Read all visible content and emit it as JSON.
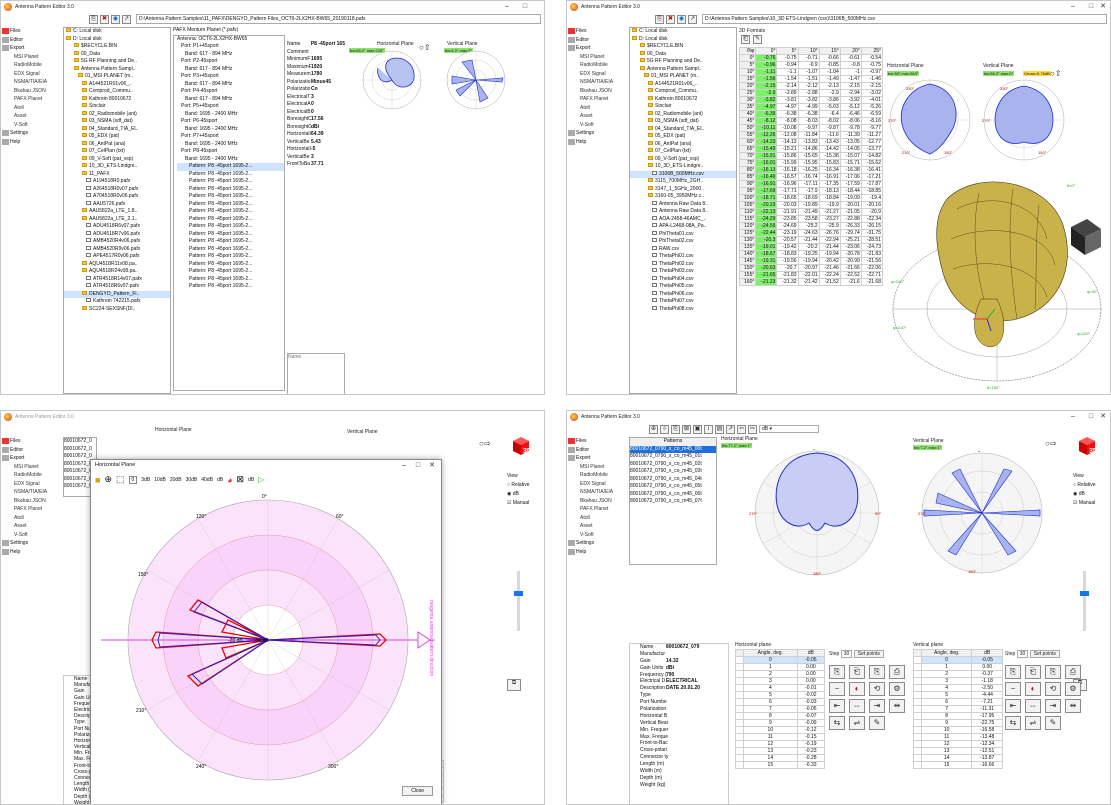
{
  "app_title": "Antenna Pattern Editor 3.0",
  "window_controls": {
    "min": "–",
    "max": "□",
    "close": "✕"
  },
  "sidebar": [
    {
      "label": "Files",
      "level": 0
    },
    {
      "label": "Editor",
      "level": 0
    },
    {
      "label": "Export",
      "level": 0
    },
    {
      "label": "MSI Planet",
      "level": 1
    },
    {
      "label": "RadioMobile",
      "level": 1
    },
    {
      "label": "EDX Signal",
      "level": 1
    },
    {
      "label": "NSMA/TIA/EIA",
      "level": 1
    },
    {
      "label": "Bkahau JSON",
      "level": 1
    },
    {
      "label": "PAFX Planet",
      "level": 1
    },
    {
      "label": "Atoll",
      "level": 1
    },
    {
      "label": "Asset",
      "level": 1
    },
    {
      "label": "V-Soft",
      "level": 1
    },
    {
      "label": "Settings",
      "level": 0
    },
    {
      "label": "Help",
      "level": 0
    }
  ],
  "view": {
    "label": "View",
    "relative": "Relative",
    "db": "dB",
    "manual": "Manual",
    "btn3d": "3D"
  },
  "win1": {
    "path": "D:\\Antenna Pattern Samples\\11_PAFX\\DENGYO_Pattern Files_OCT6-2LX2HX-BW65_20190118.pafx",
    "folders": [
      "C: Local disk",
      "D: Local disk",
      "$RECYCLE.BIN",
      "00_Data",
      "5G RF Planning and De..",
      "Antenna Pattern Sampl..",
      "01_MSI PLANET (m..",
      "A144521R01v06_..",
      "Comprod_Commu..",
      "Kathrein 80010672",
      "Sinclair",
      "02_Radiomobile (ant)",
      "03_NSMA (sdf_dat)",
      "04_Standard_TIA_EI..",
      "05_EDX (pat)",
      "06_AntPat (ana)",
      "07_CelPlan (txt)",
      "09_V-Soft (pat_vsp)",
      "10_3D_ETS-Lindgre..",
      "11_PAFX",
      "A194518R0.pafx",
      "A264518R0v07.pafx",
      "A704518R0v06.pafx",
      "AAU5726.pafx",
      "AAU5822a_LTE_1.8..",
      "AAU5822a_LTE_2.1..",
      "ADU4518R6v07.pafx",
      "ADU4518R7v06.pafx",
      "AMB4520R4v06.pafx",
      "AMB4520R9v06.pafx",
      "APE4517R0v06.pafx",
      "AQU4518R11v08.pa..",
      "AQU4518R24v08.pa..",
      "ATR4518R14v07.pafx",
      "ATR4518R6v07.pafx",
      "DENGYO_Pattern_Fi..",
      "Kathrein 742215.pafx",
      "SC224-SEXSNF(DI.."
    ],
    "pafx_header": "PAFX Mentum Planet (*.pafx)",
    "pafx_items": [
      "Antenna: OCT6-2LX2HX-BW65",
      "Port: P1+45sport",
      "Band: 617 - 894 MHz",
      "Port: P2-45sport",
      "Band: 617 - 894 MHz",
      "Port: P3+45sport",
      "Band: 617 - 894 MHz",
      "Port: P4-45sport",
      "Band: 617 - 894 MHz",
      "Port: P5+45sport",
      "Band: 1695 - 2400 MHz",
      "Port: P6-45sport",
      "Band: 1695 - 2400 MHz",
      "Port: P7+45sport",
      "Band: 1695 - 2400 MHz",
      "Port: P8-45sport",
      "Band: 1695 - 2400 MHz",
      "Pattern: P8 -45port 1695-2...",
      "Pattern: P8 -45port 1695-2...",
      "Pattern: P8 -45port 1695-2...",
      "Pattern: P8 -45port 1695-2...",
      "Pattern: P8 -45port 1695-2...",
      "Pattern: P8 -45port 1695-2...",
      "Pattern: P8 -45port 1695-2...",
      "Pattern: P8 -45port 1695-2...",
      "Pattern: P8 -45port 1695-2...",
      "Pattern: P8 -45port 1695-2...",
      "Pattern: P8 -45port 1695-2...",
      "Pattern: P8 -45port 1695-2...",
      "Pattern: P8 -45port 1695-2...",
      "Pattern: P8 -45port 1695-2...",
      "Pattern: P8 -45port 1695-2...",
      "Pattern: P8 -45port 1695-2...",
      "Pattern: P8 -45port 1695-2..."
    ],
    "props": [
      [
        "Name",
        "P8 -45port 165"
      ],
      [
        "Comment",
        ""
      ],
      [
        "MinimumF",
        "1695"
      ],
      [
        "MaximumF",
        "1920"
      ],
      [
        "Measurem",
        "1780"
      ],
      [
        "Polarizatio",
        "Minus45"
      ],
      [
        "Polarizatio",
        "Co"
      ],
      [
        "ElectricalT",
        "3"
      ],
      [
        "ElectricalA",
        "0"
      ],
      [
        "ElectricalB",
        "0"
      ],
      [
        "BoresightC",
        "17.56"
      ],
      [
        "BoresightG",
        "dBi"
      ],
      [
        "HorizontalI",
        "64.39"
      ],
      [
        "VerticalBe",
        "5.43"
      ],
      [
        "HorizontalI",
        "-5"
      ],
      [
        "VerticalBe",
        "3"
      ],
      [
        "FrontToBa",
        "37.71"
      ]
    ],
    "name_label": "Name",
    "h_plane": "Horizontal Plane",
    "h_badge": "bw:65.2° max:233°",
    "v_plane": "Vertical Plane",
    "v_badge": "bw:4.3° max:3°"
  },
  "win2": {
    "path": "D:\\Antenna Pattern Samples\\10_3D ETS-Lindgren (csv)\\3106B_500MHz.csv",
    "formats": "3D Formats",
    "folders": [
      "C: Local disk",
      "D: Local disk",
      "$RECYCLE.BIN",
      "00_Data",
      "5G RF Planning and De..",
      "Antenna Pattern Sampl..",
      "01_MSI PLANET (m..",
      "A144521R01v06_..",
      "Comprod_Commu..",
      "Kathrein 80010672",
      "Sinclair",
      "02_Radiomobile (ant)",
      "03_NSMA (sdf_dat)",
      "04_Standard_TIA_EI..",
      "05_EDX (pat)",
      "06_AntPat (ana)",
      "07_CelPlan (txt)",
      "09_V-Soft (pat_vsp)",
      "10_3D_ETS-Lindgre..",
      "3106B_500MHz.csv",
      "3115_700MHz_2GH..",
      "3147_1_5GHz_2000..",
      "3160-05_3950MHz.c..",
      "Antenna Raw Data 8..",
      "Antenna Raw Data 8..",
      "AOA-2458-46AMC_..",
      "APA-L2468-08A_Pa..",
      "PhiTheta01.csv",
      "PhiTheta02.csv",
      "RAW.csv",
      "ThetaPhi01.csv",
      "ThetaPhi02.csv",
      "ThetaPhi03.csv",
      "ThetaPhi04.csv",
      "ThetaPhi05.csv",
      "ThetaPhi06.csv",
      "ThetaPhi07.csv",
      "ThetaPhi08.csv"
    ],
    "grid_header": [
      "θ\\φ",
      "0°",
      "5°",
      "10°",
      "15°",
      "20°",
      "25°"
    ],
    "grid": [
      [
        "0°",
        "-0.76",
        "-0.75",
        "-0.71",
        "-0.66",
        "-0.61",
        "-0.54"
      ],
      [
        "5°",
        "-0.96",
        "-0.94",
        "-0.9",
        "-0.85",
        "-0.8",
        "-0.75"
      ],
      [
        "10°",
        "-1.11",
        "-1.1",
        "-1.07",
        "-1.04",
        "-1",
        "-0.97"
      ],
      [
        "15°",
        "-1.56",
        "-1.54",
        "-1.51",
        "-1.49",
        "-1.47",
        "-1.46"
      ],
      [
        "20°",
        "-2.15",
        "-2.14",
        "-2.12",
        "-2.13",
        "-2.15",
        "-2.15"
      ],
      [
        "25°",
        "-2.9",
        "-2.89",
        "-2.88",
        "-2.9",
        "-2.94",
        "-3.02"
      ],
      [
        "30°",
        "-3.82",
        "-3.81",
        "-3.82",
        "-3.86",
        "-3.92",
        "-4.01"
      ],
      [
        "35°",
        "-4.97",
        "-4.97",
        "-4.99",
        "-5.03",
        "-5.12",
        "-5.26"
      ],
      [
        "40°",
        "-6.39",
        "-6.38",
        "-6.38",
        "-6.4",
        "-6.46",
        "-6.59"
      ],
      [
        "45°",
        "-8.12",
        "-8.08",
        "-8.03",
        "-8.02",
        "-8.06",
        "-8.16"
      ],
      [
        "50°",
        "-10.11",
        "-10.08",
        "-9.97",
        "-9.87",
        "-9.78",
        "-9.77"
      ],
      [
        "55°",
        "-12.26",
        "-12.08",
        "-11.84",
        "-11.6",
        "-11.39",
        "-11.27"
      ],
      [
        "60°",
        "-14.23",
        "-14.13",
        "-13.83",
        "-13.43",
        "-13.05",
        "-12.77"
      ],
      [
        "65°",
        "-15.49",
        "-15.21",
        "-14.86",
        "-14.42",
        "-14.05",
        "-13.77"
      ],
      [
        "70°",
        "-15.91",
        "-15.86",
        "-15.65",
        "-15.38",
        "-15.07",
        "-14.82"
      ],
      [
        "75°",
        "-16.01",
        "-15.99",
        "-15.95",
        "-15.83",
        "-15.71",
        "-15.62"
      ],
      [
        "80°",
        "-16.13",
        "-16.18",
        "-16.25",
        "-16.34",
        "-16.38",
        "-16.41"
      ],
      [
        "85°",
        "-16.49",
        "-16.57",
        "-16.74",
        "-16.91",
        "-17.06",
        "-17.21"
      ],
      [
        "90°",
        "-16.91",
        "-16.96",
        "-17.11",
        "-17.35",
        "-17.59",
        "-17.87"
      ],
      [
        "95°",
        "-17.69",
        "-17.71",
        "-17.9",
        "-18.13",
        "-18.44",
        "-18.85"
      ],
      [
        "100°",
        "-18.71",
        "-18.65",
        "-18.69",
        "-18.84",
        "-19.09",
        "-19.4"
      ],
      [
        "105°",
        "-20.23",
        "-20.03",
        "-19.89",
        "-19.9",
        "-20.01",
        "-20.16"
      ],
      [
        "110°",
        "-22.13",
        "-21.91",
        "-21.49",
        "-21.27",
        "-21.05",
        "-20.9"
      ],
      [
        "115°",
        "-24.29",
        "-23.85",
        "-23.58",
        "-23.27",
        "-22.88",
        "-22.34"
      ],
      [
        "120°",
        "-24.56",
        "-24.69",
        "-25.2",
        "-25.9",
        "-26.33",
        "-26.15"
      ],
      [
        "125°",
        "-22.44",
        "-23.19",
        "-24.63",
        "-26.76",
        "-29.74",
        "-31.75"
      ],
      [
        "130°",
        "-20.3",
        "-20.57",
        "-21.44",
        "-22.94",
        "-25.21",
        "-28.51"
      ],
      [
        "135°",
        "-19.01",
        "-19.42",
        "-20.2",
        "-21.44",
        "-23.06",
        "-24.73"
      ],
      [
        "140°",
        "-18.67",
        "-18.83",
        "-19.25",
        "-19.94",
        "-20.78",
        "-21.83"
      ],
      [
        "145°",
        "-19.31",
        "-19.56",
        "-19.94",
        "-20.42",
        "-20.99",
        "-21.56"
      ],
      [
        "150°",
        "-20.63",
        "-20.7",
        "-20.97",
        "-21.46",
        "-21.66",
        "-22.06"
      ],
      [
        "155°",
        "-21.65",
        "-21.83",
        "-22.01",
        "-22.24",
        "-22.52",
        "-22.71"
      ],
      [
        "160°",
        "-21.23",
        "-21.32",
        "-21.42",
        "-21.52",
        "-21.6",
        "-21.68"
      ]
    ],
    "h_plane": "Horizontal Plane",
    "h_badge": "bw:38°,max:263°",
    "v_plane": "Vertical Plane",
    "v_badge": "bw:56.2°,max:0°",
    "g_badge": "Gmax=0.76dB",
    "angles": [
      "0°",
      "30°",
      "60°",
      "90°",
      "120°",
      "150°",
      "180°",
      "210°",
      "240°",
      "270°",
      "300°",
      "330°"
    ]
  },
  "win3": {
    "patterns": [
      "80010672_0",
      "80010672_0",
      "80010672_0",
      "80010672_0",
      "80010672_0",
      "80010672_0",
      "80010672_0"
    ],
    "h_title": "Horizontal Plane",
    "v_title": "Vertical Plane",
    "dialog_title": "Horizontal Plane",
    "scale": [
      "3dB",
      "10dB",
      "20dB",
      "30dB",
      "40dB",
      "dB"
    ],
    "zero": "0",
    "units": "dB",
    "radial": [
      "-20 dB",
      "-10 dB"
    ],
    "mag_text": "magenta antenna pattern direction",
    "close": "Close",
    "angles": [
      "0°",
      "30°",
      "60°",
      "90°",
      "120°",
      "150°",
      "180°",
      "210°",
      "240°",
      "270°",
      "300°",
      "330°"
    ],
    "left_props": [
      "Name",
      "Manufactur",
      "Gain",
      "Gain Un",
      "Frequen",
      "Electrica",
      "Descript",
      "Type",
      "Port Nur",
      "Polarizat",
      "Horizont",
      "Vertical E",
      "Min. Fre",
      "Max. Fre",
      "Front-to-Bac",
      "Cross-polari",
      "Connector ty",
      "Length (m)",
      "Width (m)",
      "Depth (m)",
      "Weight (kg)"
    ],
    "h_rows": [
      [
        "10",
        "-0.12"
      ],
      [
        "11",
        "-0.15"
      ],
      [
        "12",
        "-0.19"
      ],
      [
        "13",
        "-0.23"
      ],
      [
        "14",
        "-0.28"
      ],
      [
        "15",
        "-0.33"
      ]
    ],
    "v_rows": [
      [
        "10",
        "-16.58"
      ],
      [
        "11",
        "-13.48"
      ],
      [
        "12",
        "-12.34"
      ],
      [
        "13",
        "-12.51"
      ],
      [
        "14",
        "-13.87"
      ],
      [
        "15",
        "-16.66"
      ]
    ]
  },
  "win4": {
    "patterns_header": "Patterns",
    "patterns": [
      "80010672_0790_x_co_m45_00t",
      "80010672_0790_x_co_m45_01t",
      "80010672_0790_x_co_m45_02t",
      "80010672_0790_x_co_m45_03t",
      "80010672_0790_x_co_m45_04t",
      "80010672_0790_x_co_m45_05t",
      "80010672_0790_x_co_m45_06t",
      "80010672_0790_x_co_m45_07t"
    ],
    "h_title": "Horizontal Plane",
    "h_badge": "bw:77.2°,max:1°",
    "v_title": "Vertical Plane",
    "v_badge": "bw:7.2°,max:1°",
    "db_label": "dB",
    "props": [
      [
        "Name",
        "80010672_079"
      ],
      [
        "Manufactur",
        ""
      ],
      [
        "Gain",
        "14.32"
      ],
      [
        "Gain Units",
        "dBi"
      ],
      [
        "Frequency (",
        "790"
      ],
      [
        "Electrical D",
        "ELECTRICAL"
      ],
      [
        "Description",
        "DATE 20.01.20"
      ],
      [
        "Type",
        ""
      ],
      [
        "Port Numbe",
        ""
      ],
      [
        "Polarization",
        ""
      ],
      [
        "Horizontal B",
        ""
      ],
      [
        "Vertical Bear",
        ""
      ],
      [
        "Min. Frequer",
        ""
      ],
      [
        "Max. Freque",
        ""
      ],
      [
        "Front-to-Bac",
        ""
      ],
      [
        "Cross-polari",
        ""
      ],
      [
        "Connector ty",
        ""
      ],
      [
        "Length (m)",
        ""
      ],
      [
        "Width (m)",
        ""
      ],
      [
        "Depth (m)",
        ""
      ],
      [
        "Weight (kg)",
        ""
      ]
    ],
    "h_header": "Horizontal plane",
    "v_header": "Vertical plane",
    "col_angle": "Angle, deg.",
    "col_db": "dB",
    "step_label": "Step",
    "step_value": "30",
    "set_points": "Set points",
    "h_rows": [
      [
        "0",
        "-0.05"
      ],
      [
        "1",
        "0.00"
      ],
      [
        "2",
        "0.00"
      ],
      [
        "3",
        "0.00"
      ],
      [
        "4",
        "-0.01"
      ],
      [
        "5",
        "-0.02"
      ],
      [
        "6",
        "-0.03"
      ],
      [
        "7",
        "-0.05"
      ],
      [
        "8",
        "-0.07"
      ],
      [
        "9",
        "-0.09"
      ],
      [
        "10",
        "-0.12"
      ],
      [
        "11",
        "-0.15"
      ],
      [
        "12",
        "-0.19"
      ],
      [
        "13",
        "-0.23"
      ],
      [
        "14",
        "-0.28"
      ],
      [
        "15",
        "-0.33"
      ]
    ],
    "v_rows": [
      [
        "0",
        "-0.05"
      ],
      [
        "1",
        "0.00"
      ],
      [
        "2",
        "-0.37"
      ],
      [
        "3",
        "-1.18"
      ],
      [
        "4",
        "-2.50"
      ],
      [
        "5",
        "-4.44"
      ],
      [
        "6",
        "-7.21"
      ],
      [
        "7",
        "-11.31"
      ],
      [
        "8",
        "-17.95"
      ],
      [
        "9",
        "-22.75"
      ],
      [
        "10",
        "-16.58"
      ],
      [
        "11",
        "-13.48"
      ],
      [
        "12",
        "-12.34"
      ],
      [
        "13",
        "-12.51"
      ],
      [
        "14",
        "-13.87"
      ],
      [
        "15",
        "-16.66"
      ]
    ],
    "angles": [
      "0°",
      "30°",
      "60°",
      "90°",
      "120°",
      "150°",
      "180°",
      "210°",
      "240°",
      "270°",
      "300°",
      "330°"
    ]
  }
}
